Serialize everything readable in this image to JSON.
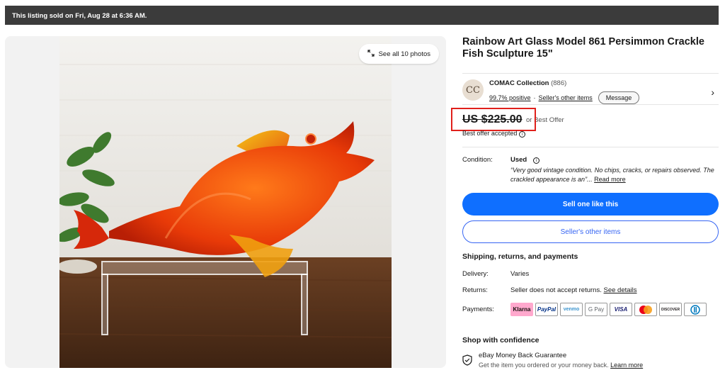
{
  "banner": "This listing sold on Fri, Aug 28 at 6:36 AM.",
  "gallery": {
    "see_all": "See all 10 photos"
  },
  "item": {
    "title": "Rainbow Art Glass Model 861 Persimmon Crackle Fish Sculpture 15\""
  },
  "seller": {
    "avatar_text": "CC",
    "name": "COMAC Collection",
    "count": "(886)",
    "positive": "99.7% positive",
    "separator": "·",
    "other_items": "Seller's other items",
    "message": "Message"
  },
  "price": {
    "value": "US $225.00",
    "or_text": "or Best Offer",
    "accepted": "Best offer accepted"
  },
  "condition": {
    "label": "Condition:",
    "value": "Used",
    "quote": "“Very good vintage condition. No chips, cracks, or repairs observed. The crackled appearance is an”...",
    "read_more": "Read more"
  },
  "buttons": {
    "sell_one": "Sell one like this",
    "other_items": "Seller's other items"
  },
  "shipping": {
    "title": "Shipping, returns, and payments",
    "delivery_label": "Delivery:",
    "delivery_value": "Varies",
    "returns_label": "Returns:",
    "returns_value": "Seller does not accept returns.",
    "returns_link": "See details",
    "payments_label": "Payments:"
  },
  "payments": [
    "Klarna",
    "PayPal",
    "venmo",
    "G Pay",
    "VISA",
    "",
    "DISCOVER",
    ""
  ],
  "confidence": {
    "title": "Shop with confidence",
    "guarantee": "eBay Money Back Guarantee",
    "desc": "Get the item you ordered or your money back.",
    "learn": "Learn more"
  },
  "colors": {
    "primary": "#0f6fff",
    "link": "#3665f3",
    "highlight": "#e0201b",
    "banner": "#3b3b3b"
  }
}
